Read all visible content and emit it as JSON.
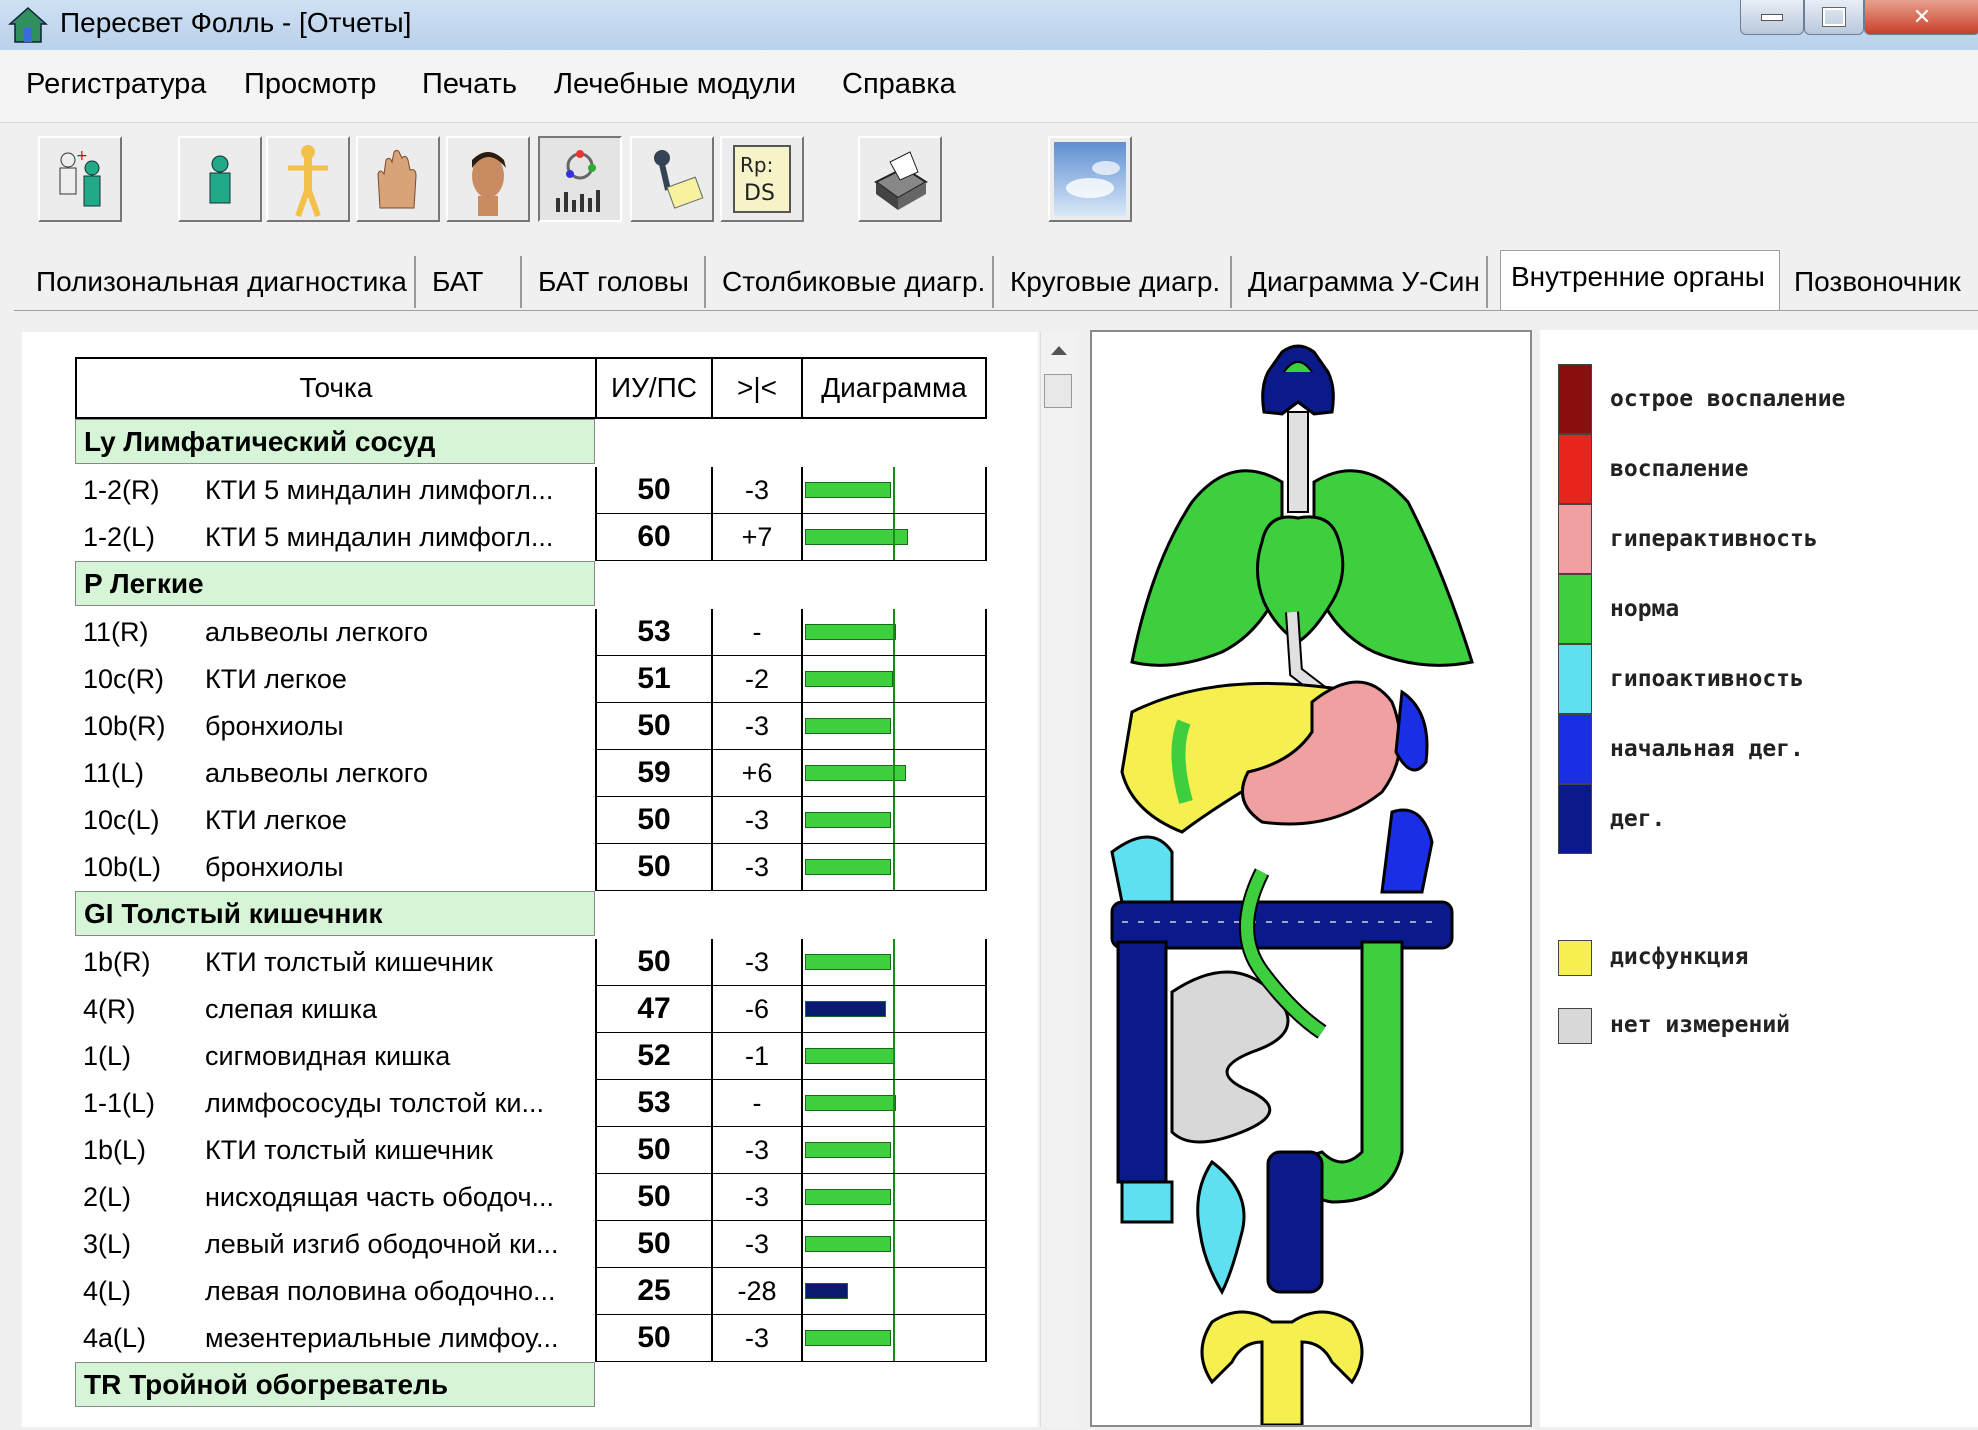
{
  "window": {
    "title": "Пересвет Фолль - [Отчеты]"
  },
  "menu": [
    "Регистратура",
    "Просмотр",
    "Печать",
    "Лечебные модули",
    "Справка"
  ],
  "toolbar": [
    {
      "name": "patients-icon"
    },
    {
      "name": "person-icon"
    },
    {
      "name": "body-points-icon"
    },
    {
      "name": "hand-icon"
    },
    {
      "name": "head-icon"
    },
    {
      "name": "chart-report-icon"
    },
    {
      "name": "measure-probe-icon"
    },
    {
      "name": "prescription-icon",
      "text": "Rp: DS"
    },
    {
      "name": "printer-icon"
    },
    {
      "name": "sky-image-icon"
    }
  ],
  "tabs": [
    "Полизональная диагностика",
    "БАТ",
    "БАТ головы",
    "Столбиковые диагр.",
    "Круговые диагр.",
    "Диаграмма У-Син",
    "Внутренние органы",
    "Позвоночник"
  ],
  "active_tab": "Внутренние органы",
  "table": {
    "headers": [
      "Точка",
      "ИУ/ПС",
      ">|<",
      "Диаграмма"
    ],
    "groups": [
      {
        "title": "Ly  Лимфатический сосуд",
        "rows": [
          {
            "code": "1-2(R)",
            "name": "КТИ 5 миндалин лимфогл...",
            "iu": "50",
            "diff": "-3",
            "bar": 50,
            "color": "green"
          },
          {
            "code": "1-2(L)",
            "name": "КТИ 5 миндалин лимфогл...",
            "iu": "60",
            "diff": "+7",
            "bar": 60,
            "color": "green"
          }
        ]
      },
      {
        "title": "P  Легкие",
        "rows": [
          {
            "code": "11(R)",
            "name": "альвеолы легкого",
            "iu": "53",
            "diff": "-",
            "bar": 53,
            "color": "green"
          },
          {
            "code": "10c(R)",
            "name": "КТИ легкое",
            "iu": "51",
            "diff": "-2",
            "bar": 51,
            "color": "green"
          },
          {
            "code": "10b(R)",
            "name": "бронхиолы",
            "iu": "50",
            "diff": "-3",
            "bar": 50,
            "color": "green"
          },
          {
            "code": "11(L)",
            "name": "альвеолы легкого",
            "iu": "59",
            "diff": "+6",
            "bar": 59,
            "color": "green"
          },
          {
            "code": "10c(L)",
            "name": "КТИ легкое",
            "iu": "50",
            "diff": "-3",
            "bar": 50,
            "color": "green"
          },
          {
            "code": "10b(L)",
            "name": "бронхиолы",
            "iu": "50",
            "diff": "-3",
            "bar": 50,
            "color": "green"
          }
        ]
      },
      {
        "title": "GI  Толстый кишечник",
        "rows": [
          {
            "code": "1b(R)",
            "name": "КТИ толстый кишечник",
            "iu": "50",
            "diff": "-3",
            "bar": 50,
            "color": "green"
          },
          {
            "code": "4(R)",
            "name": "слепая кишка",
            "iu": "47",
            "diff": "-6",
            "bar": 47,
            "color": "navy"
          },
          {
            "code": "1(L)",
            "name": "сигмовидная кишка",
            "iu": "52",
            "diff": "-1",
            "bar": 52,
            "color": "green"
          },
          {
            "code": "1-1(L)",
            "name": "лимфососуды толстой ки...",
            "iu": "53",
            "diff": "-",
            "bar": 53,
            "color": "green"
          },
          {
            "code": "1b(L)",
            "name": "КТИ толстый кишечник",
            "iu": "50",
            "diff": "-3",
            "bar": 50,
            "color": "green"
          },
          {
            "code": "2(L)",
            "name": "нисходящая часть ободоч...",
            "iu": "50",
            "diff": "-3",
            "bar": 50,
            "color": "green"
          },
          {
            "code": "3(L)",
            "name": "левый изгиб ободочной ки...",
            "iu": "50",
            "diff": "-3",
            "bar": 50,
            "color": "green"
          },
          {
            "code": "4(L)",
            "name": "левая половина ободочно...",
            "iu": "25",
            "diff": "-28",
            "bar": 25,
            "color": "navy"
          },
          {
            "code": "4a(L)",
            "name": "мезентериальные лимфоу...",
            "iu": "50",
            "diff": "-3",
            "bar": 50,
            "color": "green"
          }
        ]
      },
      {
        "title": "TR  Тройной обогреватель",
        "rows": []
      }
    ]
  },
  "legend": [
    {
      "label": "острое воспаление",
      "color": "#8b0e0e"
    },
    {
      "label": "воспаление",
      "color": "#e8241c"
    },
    {
      "label": "гиперактивность",
      "color": "#f0a0a0"
    },
    {
      "label": "норма",
      "color": "#3ecf3e"
    },
    {
      "label": "гипоактивность",
      "color": "#5fe0f0"
    },
    {
      "label": "начальная дег.",
      "color": "#1a2ee6"
    },
    {
      "label": "дег.",
      "color": "#0a1a8a"
    },
    {
      "label": "дисфункция",
      "color": "#f5f050"
    },
    {
      "label": "нет измерений",
      "color": "#d8d8d8"
    }
  ],
  "colors": {
    "green": "#3ecf3e",
    "navy": "#0a1a6e",
    "group_bg": "#d6f5d6"
  }
}
